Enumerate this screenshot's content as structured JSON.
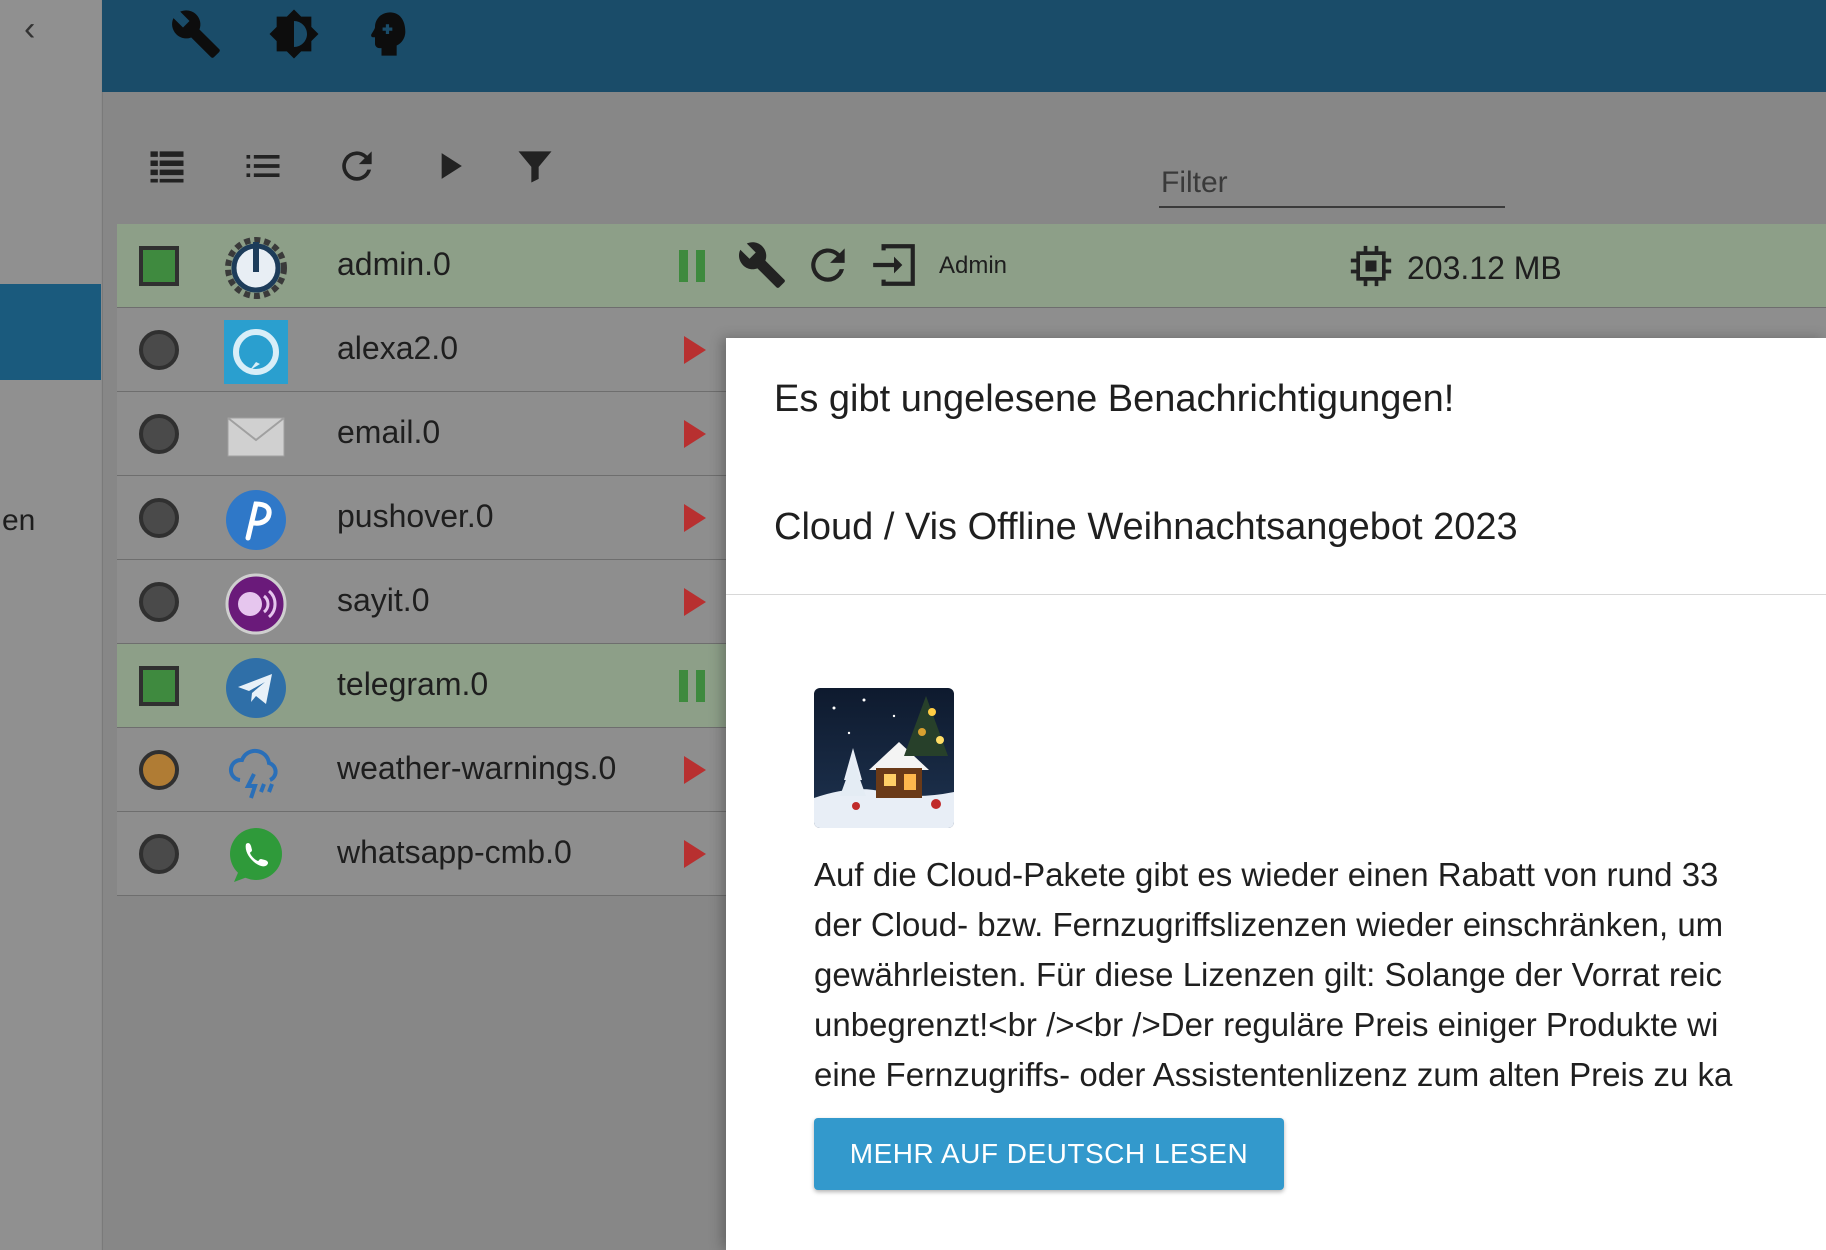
{
  "sidebar": {
    "back_glyph": "‹",
    "label_fragment": "en"
  },
  "topbar": {
    "icons": [
      "wrench-icon",
      "brightness-icon",
      "expert-head-icon"
    ]
  },
  "toolbar": {
    "icons": [
      "list-detail-icon",
      "list-compact-icon",
      "refresh-icon",
      "play-icon",
      "filter-icon"
    ],
    "filter_placeholder": "Filter"
  },
  "adapters": [
    {
      "name": "admin.0",
      "state": "running",
      "logo": "admin-logo",
      "link_label": "Admin",
      "memory": "203.12 MB"
    },
    {
      "name": "alexa2.0",
      "state": "stopped",
      "logo": "alexa-logo"
    },
    {
      "name": "email.0",
      "state": "stopped",
      "logo": "email-logo"
    },
    {
      "name": "pushover.0",
      "state": "stopped",
      "logo": "pushover-logo"
    },
    {
      "name": "sayit.0",
      "state": "stopped",
      "logo": "sayit-logo"
    },
    {
      "name": "telegram.0",
      "state": "running",
      "logo": "telegram-logo"
    },
    {
      "name": "weather-warnings.0",
      "state": "warning",
      "logo": "weather-warnings-logo"
    },
    {
      "name": "whatsapp-cmb.0",
      "state": "stopped",
      "logo": "whatsapp-logo"
    }
  ],
  "dialog": {
    "title": "Es gibt ungelesene Benachrichtigungen!",
    "subtitle": "Cloud / Vis Offline Weihnachtsangebot 2023",
    "body_lines": [
      "Auf die Cloud-Pakete gibt es wieder einen Rabatt von rund 33",
      "der Cloud- bzw. Fernzugriffslizenzen wieder einschränken, um",
      "gewährleisten. Für diese Lizenzen gilt: Solange der Vorrat reic",
      "unbegrenzt!<br /><br />Der reguläre Preis einiger Produkte wi",
      "eine Fernzugriffs- oder Assistentenlizenz zum alten Preis zu ka"
    ],
    "button_label": "MEHR AUF DEUTSCH LESEN"
  },
  "colors": {
    "topbar": "#1a4c69",
    "accent": "#3399cc",
    "running": "#3e8a3e",
    "stopped": "#b83030"
  }
}
